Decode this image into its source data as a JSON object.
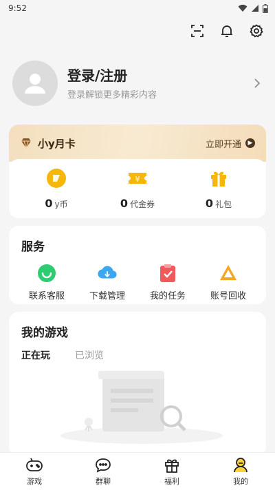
{
  "status_bar": {
    "time": "9:52"
  },
  "top_actions": [
    "scan-icon",
    "bell-icon",
    "settings-icon"
  ],
  "profile": {
    "title": "登录/注册",
    "subtitle": "登录解锁更多精彩内容"
  },
  "vip_card": {
    "title": "小y月卡",
    "action": "立即开通",
    "items": [
      {
        "count": "0",
        "label": "y币",
        "icon": "y-coin-icon",
        "color": "#f5b70c"
      },
      {
        "count": "0",
        "label": "代金券",
        "icon": "voucher-icon",
        "color": "#f5b70c"
      },
      {
        "count": "0",
        "label": "礼包",
        "icon": "gift-icon",
        "color": "#f5b70c"
      }
    ]
  },
  "services": {
    "title": "服务",
    "items": [
      {
        "label": "联系客服",
        "icon": "customer-service-icon",
        "color": "#2ecc71"
      },
      {
        "label": "下载管理",
        "icon": "download-icon",
        "color": "#3aa7f0"
      },
      {
        "label": "我的任务",
        "icon": "task-icon",
        "color": "#f05a5a"
      },
      {
        "label": "账号回收",
        "icon": "recycle-icon",
        "color": "#f5a623"
      }
    ]
  },
  "games": {
    "title": "我的游戏",
    "tabs": [
      {
        "label": "正在玩",
        "active": true
      },
      {
        "label": "已浏览",
        "active": false
      }
    ]
  },
  "bottom_nav": [
    {
      "label": "游戏",
      "icon": "gamepad-icon"
    },
    {
      "label": "群聊",
      "icon": "chat-icon"
    },
    {
      "label": "福利",
      "icon": "gift-box-icon"
    },
    {
      "label": "我的",
      "icon": "user-icon",
      "active": true
    }
  ],
  "colors": {
    "accent": "#ffd43b",
    "vip_bg": "#f3dfbe"
  }
}
